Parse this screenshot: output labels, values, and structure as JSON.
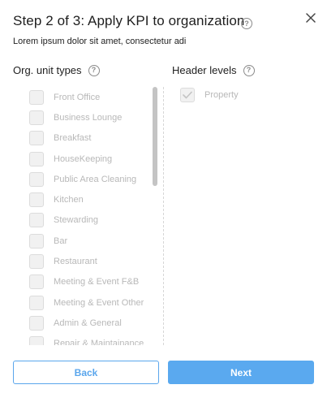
{
  "dialog": {
    "title": "Step 2 of 3: Apply KPI to organization",
    "subtitle": "Lorem ipsum dolor sit amet, consectetur adi",
    "help_glyph": "?"
  },
  "left_column": {
    "heading": "Org. unit types",
    "items": [
      "Front Office",
      "Business Lounge",
      "Breakfast",
      "HouseKeeping",
      "Public Area Cleaning",
      "Kitchen",
      "Stewarding",
      "Bar",
      "Restaurant",
      "Meeting & Event F&B",
      "Meeting & Event Other",
      "Admin & General",
      "Repair & Maintainance"
    ]
  },
  "right_column": {
    "heading": "Header levels",
    "items": [
      {
        "label": "Property",
        "checked": true
      }
    ]
  },
  "buttons": {
    "back": "Back",
    "next": "Next"
  },
  "colors": {
    "accent": "#5aa9ef",
    "disabled_text": "#b8b8b8"
  },
  "icons": {
    "close": "close-icon",
    "help": "help-circle-icon",
    "check": "checkmark-icon"
  }
}
